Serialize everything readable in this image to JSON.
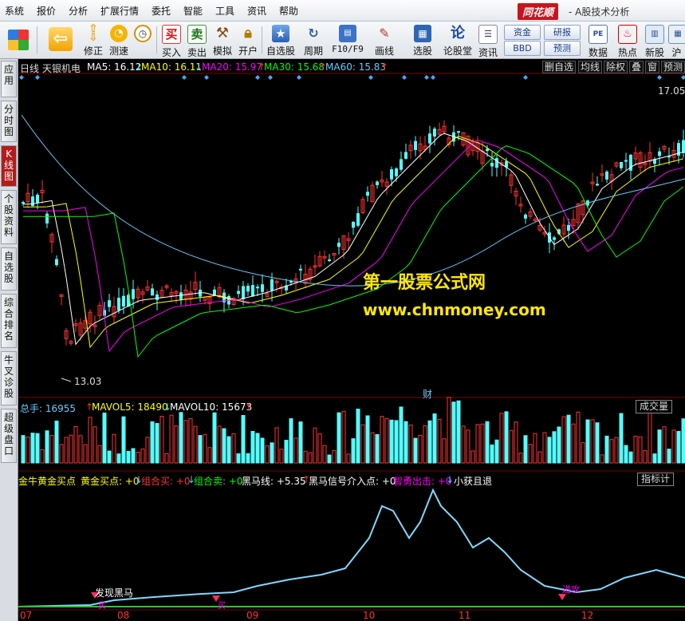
{
  "menubar": {
    "items": [
      "系统",
      "报价",
      "分析",
      "扩展行情",
      "委托",
      "智能",
      "工具",
      "资讯",
      "帮助"
    ],
    "brand_logo": "同花顺",
    "brand_sub": "- A股技术分析"
  },
  "toolbar": {
    "buttons": [
      {
        "label": "",
        "icon": "block-icon"
      },
      {
        "label": "",
        "icon": "back-arrow-icon"
      },
      {
        "label": "修正",
        "icon": "up-down-arrow-icon"
      },
      {
        "label": "测速",
        "icon": "clock-icon"
      },
      {
        "label": "买入",
        "icon": "buy-icon",
        "glyph": "买"
      },
      {
        "label": "卖出",
        "icon": "sell-icon",
        "glyph": "卖"
      },
      {
        "label": "模拟",
        "icon": "hammer-icon"
      },
      {
        "label": "开户",
        "icon": "lock-icon"
      },
      {
        "label": "自选股",
        "icon": "star-folder-icon"
      },
      {
        "label": "周期",
        "icon": "cycle-icon"
      },
      {
        "label": "F10/F9",
        "icon": "f10-icon"
      },
      {
        "label": "画线",
        "icon": "pen-icon"
      },
      {
        "label": "选股",
        "icon": "screen-icon"
      },
      {
        "label": "论股堂",
        "icon": "forum-icon",
        "glyph": "论"
      },
      {
        "label": "资讯",
        "icon": "info-icon"
      },
      {
        "label": "数据",
        "icon": "pe-icon",
        "glyph": "PE"
      },
      {
        "label": "热点",
        "icon": "hot-icon"
      },
      {
        "label": "新股",
        "icon": "new-stock-icon"
      },
      {
        "label": "沪",
        "icon": "sh-icon"
      }
    ],
    "boxes": [
      "资金",
      "研报",
      "BBD",
      "预测"
    ]
  },
  "lefttabs": [
    "应用",
    "分时图",
    "K线图",
    "个股资料",
    "自选股",
    "综合排名",
    "牛叉诊股",
    "超级盘口"
  ],
  "chart": {
    "kline_legend": {
      "period": "日线",
      "stock": "天银机电",
      "ma5": "MA5: 16.12",
      "ma10": "MA10: 16.11",
      "ma20": "MA20: 15.97",
      "ma30": "MA30: 15.68",
      "ma60": "MA60: 15.83",
      "colors": {
        "ma5": "#ffffff",
        "ma10": "#ffff00",
        "ma20": "#ff00ff",
        "ma30": "#00ff00",
        "ma60": "#66ccff"
      }
    },
    "right_buttons": [
      "删自选",
      "均线",
      "除权",
      "叠",
      "窗",
      "预测"
    ],
    "price_high": "17.05",
    "price_low": "13.03",
    "fin_marker": "财",
    "watermark_title": "第一股票公式网",
    "watermark_url": "www.chnmoney.com",
    "volume_legend": {
      "total": "总手: 16955",
      "mavol5": "MAVOL5: 18490",
      "mavol10": "MAVOL10: 15673"
    },
    "volume_button": "成交量",
    "indicator_legend": {
      "name": "金牛黄金买点",
      "gold": "黄金买点: +0",
      "combo_buy": "组合买: +0",
      "combo_sell": "组合卖: +0",
      "horse_line": "黑马线: +5.35",
      "horse_signal": "黑马信号介入点: +0",
      "brave_exit": "智勇出击: +0",
      "small_gain": "小获且退"
    },
    "indicator_button": "指标计",
    "annotations": [
      "发现黑马",
      "买",
      "进攻",
      "买"
    ],
    "x_axis": [
      "07",
      "08",
      "09",
      "10",
      "11",
      "12"
    ],
    "colors": {
      "up": "#ff3232",
      "down": "#54ffff",
      "background": "#000000",
      "grid": "#800000",
      "indicator_line": "#7fd9ff"
    }
  }
}
